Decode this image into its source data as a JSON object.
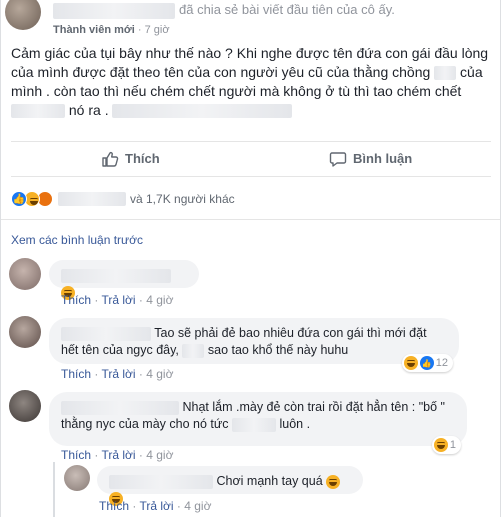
{
  "post": {
    "shared_text": "đã chia sẻ bài viết đầu tiên của cô ấy.",
    "member_badge": "Thành viên mới",
    "separator": "·",
    "time": "7 giờ",
    "body_part1": "Cảm giác của tụi bây như thế nào ? Khi nghe được tên đứa con gái đầu lòng của mình được đặt theo tên của con người yêu cũ của thằng chồng",
    "body_part2": "của mình . còn tao thì nếu chém chết người mà không ở tù thì tao chém chết",
    "body_part3": "nó ra ."
  },
  "actions": {
    "like_label": "Thích",
    "comment_label": "Bình luận"
  },
  "reactions": {
    "summary": "và 1,7K người khác"
  },
  "comments": {
    "view_previous": "Xem các bình luận trước",
    "list": [
      {
        "text": "",
        "like_label": "Thích",
        "reply_label": "Trả lời",
        "time": "4 giờ"
      },
      {
        "text_part1": "Tao sẽ phải đẻ bao nhiêu đứa con gái thì mới đặt hết tên của ngyc đây,",
        "text_part2": "sao tao khổ thế này huhu",
        "reaction_count": "12",
        "like_label": "Thích",
        "reply_label": "Trả lời",
        "time": "4 giờ"
      },
      {
        "text_part1": "Nhạt lắm .mày đẻ còn trai rồi đặt hẳn tên : \"bố \" thằng nyc của mày cho nó tức",
        "text_part2": "luôn .",
        "reaction_count": "1",
        "like_label": "Thích",
        "reply_label": "Trả lời",
        "time": "4 giờ"
      }
    ],
    "reply": {
      "text": "Chơi mạnh tay quá",
      "like_label": "Thích",
      "reply_label": "Trả lời",
      "time": "4 giờ"
    }
  },
  "colors": {
    "link": "#385898",
    "meta": "#90949c",
    "bubble": "#f2f3f5",
    "like_blue": "#1877f2",
    "haha_yellow": "#f7b125"
  }
}
